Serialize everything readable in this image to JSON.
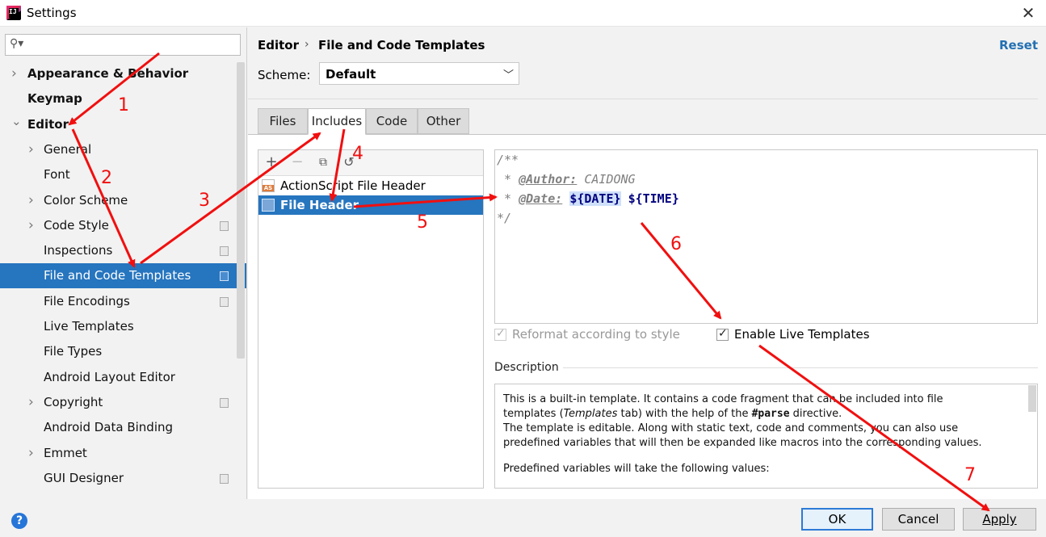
{
  "window": {
    "title": "Settings"
  },
  "sidebar": {
    "search_placeholder": "",
    "items": [
      {
        "label": "Appearance & Behavior",
        "level": 0,
        "expandable": true,
        "bold": true
      },
      {
        "label": "Keymap",
        "level": 0,
        "expandable": false,
        "bold": true
      },
      {
        "label": "Editor",
        "level": 0,
        "expanded": true,
        "bold": true
      },
      {
        "label": "General",
        "level": 1,
        "expandable": true
      },
      {
        "label": "Font",
        "level": 1
      },
      {
        "label": "Color Scheme",
        "level": 1,
        "expandable": true
      },
      {
        "label": "Code Style",
        "level": 1,
        "expandable": true,
        "project": true
      },
      {
        "label": "Inspections",
        "level": 1,
        "project": true
      },
      {
        "label": "File and Code Templates",
        "level": 1,
        "project": true,
        "selected": true
      },
      {
        "label": "File Encodings",
        "level": 1,
        "project": true
      },
      {
        "label": "Live Templates",
        "level": 1
      },
      {
        "label": "File Types",
        "level": 1
      },
      {
        "label": "Android Layout Editor",
        "level": 1
      },
      {
        "label": "Copyright",
        "level": 1,
        "expandable": true,
        "project": true
      },
      {
        "label": "Android Data Binding",
        "level": 1
      },
      {
        "label": "Emmet",
        "level": 1,
        "expandable": true
      },
      {
        "label": "GUI Designer",
        "level": 1,
        "project": true
      }
    ]
  },
  "header": {
    "breadcrumb": [
      "Editor",
      "File and Code Templates"
    ],
    "breadcrumb_sep": "›",
    "reset_label": "Reset"
  },
  "scheme": {
    "label": "Scheme:",
    "value": "Default"
  },
  "tabs": [
    {
      "label": "Files"
    },
    {
      "label": "Includes",
      "active": true
    },
    {
      "label": "Code"
    },
    {
      "label": "Other"
    }
  ],
  "templates": [
    {
      "label": "ActionScript File Header",
      "icon": "actionscript-file-icon",
      "icon_text": "AS"
    },
    {
      "label": "File Header",
      "icon": "file-template-icon",
      "selected": true
    }
  ],
  "editor": {
    "line1": "/**",
    "line2_prefix": " * ",
    "line2_tag": "@Author:",
    "line2_value": " CAIDONG",
    "line3_prefix": " * ",
    "line3_tag": "@Date:",
    "line3_var1": "${DATE}",
    "line3_var2": "${TIME}",
    "line4": "*/"
  },
  "options": {
    "reformat": {
      "label": "Reformat according to style",
      "checked": true,
      "enabled": false
    },
    "live_templates": {
      "label": "Enable Live Templates",
      "checked": true,
      "enabled": true
    }
  },
  "description": {
    "title": "Description",
    "l1": "This is a built-in template. It contains a code fragment that can be included into file",
    "l2a": "templates (",
    "l2b": "Templates",
    "l2c": " tab) with the help of the ",
    "l2d": "#parse",
    "l2e": " directive.",
    "l3": "The template is editable. Along with static text, code and comments, you can also use",
    "l4": "predefined variables that will then be expanded like macros into the corresponding values.",
    "l5": "Predefined variables will take the following values:"
  },
  "buttons": {
    "ok": "OK",
    "cancel": "Cancel",
    "apply": "Apply",
    "help": "?"
  },
  "annotations": [
    "1",
    "2",
    "3",
    "4",
    "5",
    "6",
    "7"
  ],
  "colors": {
    "selection": "#2675bf",
    "annotation": "#f10f0f",
    "link": "#2470b3"
  }
}
